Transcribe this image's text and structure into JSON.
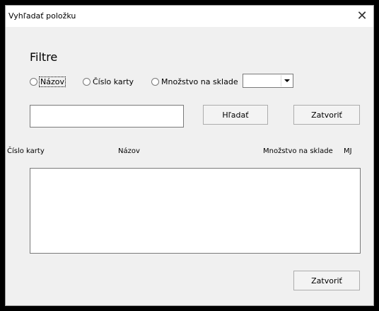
{
  "window": {
    "title": "Vyhľadať položku",
    "close_glyph": "✕"
  },
  "filters": {
    "heading": "Filtre",
    "options": [
      {
        "label": "Názov",
        "selected": false,
        "focused": true
      },
      {
        "label": "Číslo karty",
        "selected": false,
        "focused": false
      },
      {
        "label": "Množstvo na sklade",
        "selected": false,
        "focused": false
      }
    ],
    "quantity_combo_value": ""
  },
  "search": {
    "value": "",
    "search_label": "Hľadať",
    "close_label": "Zatvoriť"
  },
  "table": {
    "columns": [
      "Číslo karty",
      "Názov",
      "Množstvo na sklade",
      "MJ"
    ],
    "rows": []
  },
  "footer": {
    "close_label": "Zatvoriť"
  }
}
